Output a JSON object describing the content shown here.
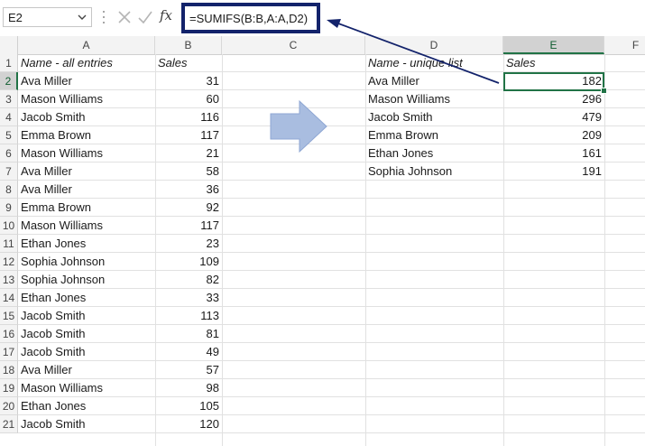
{
  "name_box": {
    "value": "E2"
  },
  "formula_bar": {
    "formula": "=SUMIFS(B:B,A:A,D2)",
    "fx_label": "fx",
    "cancel_icon": "close-icon",
    "enter_icon": "check-icon"
  },
  "columns": [
    "A",
    "B",
    "C",
    "D",
    "E",
    "F"
  ],
  "selected_column": "E",
  "selected_row": 2,
  "rows": [
    "1",
    "2",
    "3",
    "4",
    "5",
    "6",
    "7",
    "8",
    "9",
    "10",
    "11",
    "12",
    "13",
    "14",
    "15",
    "16",
    "17",
    "18",
    "19",
    "20",
    "21"
  ],
  "left_table": {
    "headers": {
      "name": "Name - all entries",
      "sales": "Sales"
    },
    "rows": [
      {
        "name": "Ava Miller",
        "sales": "31"
      },
      {
        "name": "Mason Williams",
        "sales": "60"
      },
      {
        "name": "Jacob Smith",
        "sales": "116"
      },
      {
        "name": "Emma Brown",
        "sales": "117"
      },
      {
        "name": "Mason Williams",
        "sales": "21"
      },
      {
        "name": "Ava Miller",
        "sales": "58"
      },
      {
        "name": "Ava Miller",
        "sales": "36"
      },
      {
        "name": "Emma Brown",
        "sales": "92"
      },
      {
        "name": "Mason Williams",
        "sales": "117"
      },
      {
        "name": "Ethan Jones",
        "sales": "23"
      },
      {
        "name": "Sophia Johnson",
        "sales": "109"
      },
      {
        "name": "Sophia Johnson",
        "sales": "82"
      },
      {
        "name": "Ethan Jones",
        "sales": "33"
      },
      {
        "name": "Jacob Smith",
        "sales": "113"
      },
      {
        "name": "Jacob Smith",
        "sales": "81"
      },
      {
        "name": "Jacob Smith",
        "sales": "49"
      },
      {
        "name": "Ava Miller",
        "sales": "57"
      },
      {
        "name": "Mason Williams",
        "sales": "98"
      },
      {
        "name": "Ethan Jones",
        "sales": "105"
      },
      {
        "name": "Jacob Smith",
        "sales": "120"
      }
    ]
  },
  "right_table": {
    "headers": {
      "name": "Name - unique list",
      "sales": "Sales"
    },
    "rows": [
      {
        "name": "Ava Miller",
        "sales": "182"
      },
      {
        "name": "Mason Williams",
        "sales": "296"
      },
      {
        "name": "Jacob Smith",
        "sales": "479"
      },
      {
        "name": "Emma Brown",
        "sales": "209"
      },
      {
        "name": "Ethan Jones",
        "sales": "161"
      },
      {
        "name": "Sophia Johnson",
        "sales": "191"
      }
    ]
  },
  "colors": {
    "accent_green": "#217346",
    "callout_navy": "#13236b",
    "arrow_fill": "#a9bde0"
  },
  "decorations": {
    "arrow": "right-arrow-icon"
  }
}
